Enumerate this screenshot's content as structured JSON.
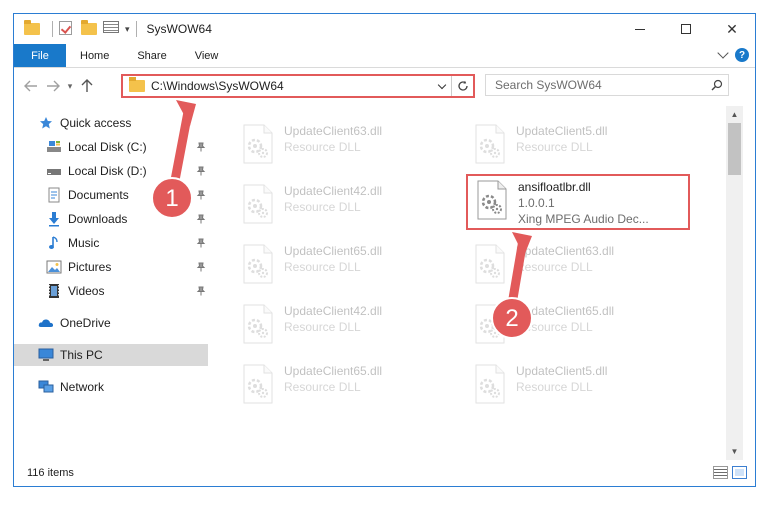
{
  "window": {
    "title": "SysWOW64",
    "controls": {
      "minimize": "",
      "maximize": "",
      "close": "✕"
    }
  },
  "quick_access_toolbar": [
    "folder-icon",
    "properties-icon",
    "new-folder-icon",
    "customize-dropdown"
  ],
  "ribbon": {
    "tabs": [
      "File",
      "Home",
      "Share",
      "View"
    ],
    "help": "?"
  },
  "address_bar": {
    "path": "C:\\Windows\\SysWOW64",
    "search_placeholder": "Search SysWOW64"
  },
  "sidebar": {
    "items": [
      {
        "label": "Quick access",
        "icon": "star-icon",
        "pinned": false
      },
      {
        "label": "Local Disk (C:)",
        "icon": "drive-icon",
        "pinned": true
      },
      {
        "label": "Local Disk (D:)",
        "icon": "drive-icon",
        "pinned": true
      },
      {
        "label": "Documents",
        "icon": "documents-icon",
        "pinned": true
      },
      {
        "label": "Downloads",
        "icon": "download-icon",
        "pinned": true
      },
      {
        "label": "Music",
        "icon": "music-icon",
        "pinned": true
      },
      {
        "label": "Pictures",
        "icon": "pictures-icon",
        "pinned": true
      },
      {
        "label": "Videos",
        "icon": "videos-icon",
        "pinned": true
      },
      {
        "label": "OneDrive",
        "icon": "onedrive-icon",
        "pinned": false
      },
      {
        "label": "This PC",
        "icon": "pc-icon",
        "pinned": false,
        "selected": true
      },
      {
        "label": "Network",
        "icon": "network-icon",
        "pinned": false
      }
    ]
  },
  "files": [
    {
      "name": "UpdateClient63.dll",
      "type": "Resource DLL",
      "faded": true
    },
    {
      "name": "UpdateClient5.dll",
      "type": "Resource DLL",
      "faded": true
    },
    {
      "name": "UpdateClient42.dll",
      "type": "Resource DLL",
      "faded": true
    },
    {
      "name": "ansifloatlbr.dll",
      "version": "1.0.0.1",
      "description": "Xing MPEG Audio Dec...",
      "faded": false,
      "highlighted": true
    },
    {
      "name": "UpdateClient65.dll",
      "type": "Resource DLL",
      "faded": true
    },
    {
      "name": "UpdateClient63.dll",
      "type": "Resource DLL",
      "faded": true
    },
    {
      "name": "UpdateClient42.dll",
      "type": "Resource DLL",
      "faded": true
    },
    {
      "name": "UpdateClient65.dll",
      "type": "Resource DLL",
      "faded": true
    },
    {
      "name": "UpdateClient65.dll",
      "type": "Resource DLL",
      "faded": true
    },
    {
      "name": "UpdateClient5.dll",
      "type": "Resource DLL",
      "faded": true
    }
  ],
  "status": {
    "item_count": "116 items"
  },
  "annotations": {
    "step1": "1",
    "step2": "2",
    "color": "#e25a5a"
  },
  "colors": {
    "accent": "#1979ca",
    "highlight_box": "#e25a5a",
    "window_border": "#2b7dd3"
  }
}
